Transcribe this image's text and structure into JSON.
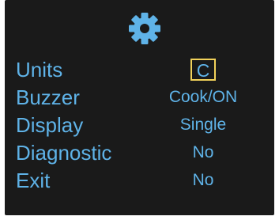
{
  "header": {
    "icon": "gear-icon"
  },
  "menu": {
    "items": [
      {
        "label": "Units",
        "value": "C",
        "selected": true
      },
      {
        "label": "Buzzer",
        "value": "Cook/ON",
        "selected": false
      },
      {
        "label": "Display",
        "value": "Single",
        "selected": false
      },
      {
        "label": "Diagnostic",
        "value": "No",
        "selected": false
      },
      {
        "label": "Exit",
        "value": "No",
        "selected": false
      }
    ]
  },
  "colors": {
    "background": "#1a1a1a",
    "text": "#5fb3e8",
    "selection_border": "#f2d25a"
  }
}
